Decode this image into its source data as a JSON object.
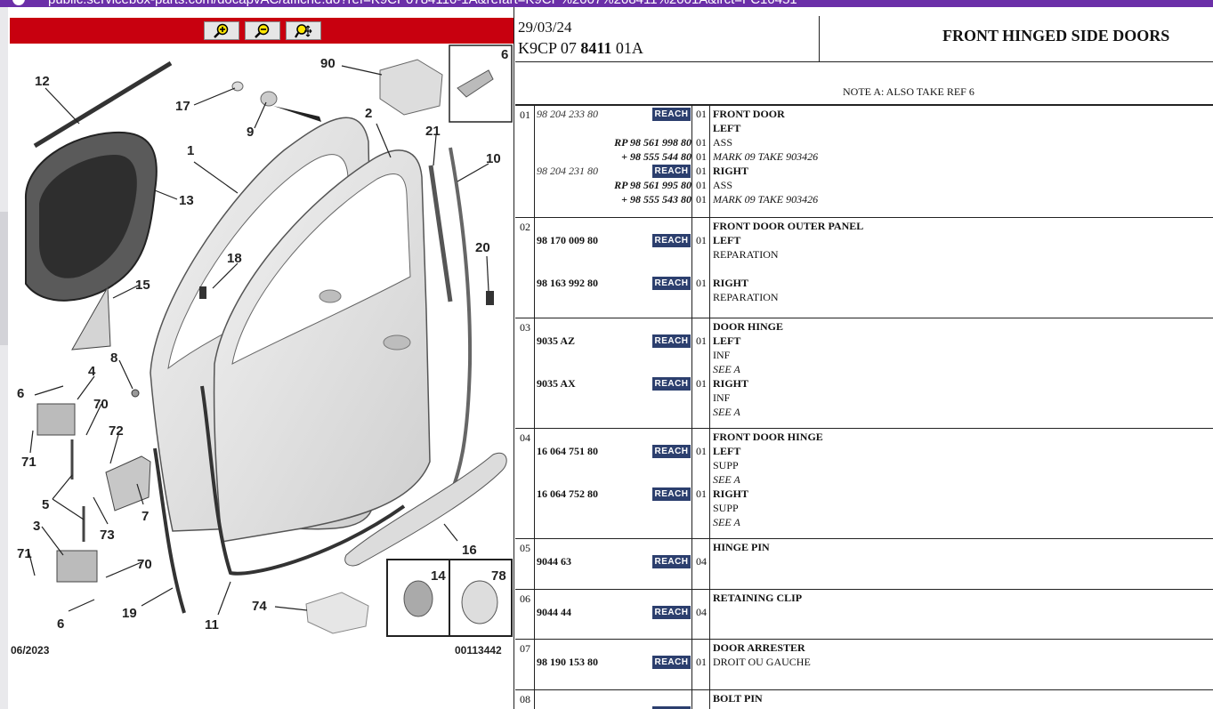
{
  "browser": {
    "url": "public.servicebox-parts.com/docapvAC/affiche.do?ref=K9CP0784110-1A&refart=K9CP%2007%208411%2001A&lrct=FC10451"
  },
  "diagram": {
    "toolbar": {
      "zoom_in": "zoom-in",
      "zoom_out": "zoom-out",
      "pan": "zoom-pan"
    },
    "labels": [
      "12",
      "17",
      "9",
      "90",
      "6",
      "2",
      "21",
      "10",
      "1",
      "13",
      "18",
      "20",
      "15",
      "8",
      "4",
      "6",
      "70",
      "72",
      "71",
      "5",
      "7",
      "73",
      "3",
      "71",
      "70",
      "6",
      "19",
      "11",
      "74",
      "14",
      "78",
      "16"
    ],
    "date": "06/2023",
    "ref": "00113442"
  },
  "header": {
    "date": "29/03/24",
    "code_prefix": "K9CP 07",
    "code_bold": "8411",
    "code_suffix": "01A",
    "title": "FRONT HINGED SIDE DOORS",
    "note": "NOTE A: ALSO TAKE REF 6"
  },
  "reach_label": "REACH",
  "rows": [
    {
      "num": "01",
      "lines": [
        {
          "ref": "98 204 233 80",
          "style": "it",
          "reach": true,
          "qty": "01",
          "desc": "FRONT DOOR",
          "dstyle": "b",
          "desc_first": true
        },
        {
          "desc": "LEFT",
          "dstyle": "b"
        },
        {
          "ref": "RP 98 561 998 80",
          "style": "rp",
          "qty": "01",
          "desc": "ASS"
        },
        {
          "ref": "+ 98 555 544 80",
          "style": "rp",
          "qty": "01",
          "desc": "MARK 09 TAKE 903426",
          "dstyle": "it"
        },
        {
          "ref": "98 204 231 80",
          "style": "it",
          "reach": true,
          "qty": "01",
          "desc": "RIGHT",
          "dstyle": "b"
        },
        {
          "ref": "RP 98 561 995 80",
          "style": "rp",
          "qty": "01",
          "desc": "ASS"
        },
        {
          "ref": "+ 98 555 543 80",
          "style": "rp",
          "qty": "01",
          "desc": "MARK 09 TAKE 903426",
          "dstyle": "it"
        }
      ]
    },
    {
      "num": "02",
      "lines": [
        {
          "desc": "FRONT DOOR OUTER PANEL",
          "dstyle": "b"
        },
        {
          "ref": "98 170 009 80",
          "style": "b",
          "reach": true,
          "qty": "01",
          "desc": "LEFT",
          "dstyle": "b"
        },
        {
          "desc": "REPARATION"
        },
        {
          "desc": ""
        },
        {
          "ref": "98 163 992 80",
          "style": "b",
          "reach": true,
          "qty": "01",
          "desc": "RIGHT",
          "dstyle": "b"
        },
        {
          "desc": "REPARATION"
        }
      ]
    },
    {
      "num": "03",
      "lines": [
        {
          "desc": "DOOR HINGE",
          "dstyle": "b"
        },
        {
          "ref": "9035 AZ",
          "style": "b",
          "reach": true,
          "qty": "01",
          "desc": "LEFT",
          "dstyle": "b"
        },
        {
          "desc": "INF"
        },
        {
          "desc": "SEE A",
          "dstyle": "it"
        },
        {
          "ref": "9035 AX",
          "style": "b",
          "reach": true,
          "qty": "01",
          "desc": "RIGHT",
          "dstyle": "b"
        },
        {
          "desc": "INF"
        },
        {
          "desc": "SEE A",
          "dstyle": "it"
        }
      ]
    },
    {
      "num": "04",
      "lines": [
        {
          "desc": "FRONT DOOR HINGE",
          "dstyle": "b"
        },
        {
          "ref": "16 064 751 80",
          "style": "b",
          "reach": true,
          "qty": "01",
          "desc": "LEFT",
          "dstyle": "b"
        },
        {
          "desc": "SUPP"
        },
        {
          "desc": "SEE A",
          "dstyle": "it"
        },
        {
          "ref": "16 064 752 80",
          "style": "b",
          "reach": true,
          "qty": "01",
          "desc": "RIGHT",
          "dstyle": "b"
        },
        {
          "desc": "SUPP"
        },
        {
          "desc": "SEE A",
          "dstyle": "it"
        }
      ]
    },
    {
      "num": "05",
      "lines": [
        {
          "desc": "HINGE PIN",
          "dstyle": "b"
        },
        {
          "ref": "9044 63",
          "style": "b",
          "reach": true,
          "qty": "04",
          "desc": ""
        }
      ]
    },
    {
      "num": "06",
      "lines": [
        {
          "desc": "RETAINING CLIP",
          "dstyle": "b"
        },
        {
          "ref": "9044 44",
          "style": "b",
          "reach": true,
          "qty": "04",
          "desc": ""
        }
      ]
    },
    {
      "num": "07",
      "lines": [
        {
          "desc": "DOOR ARRESTER",
          "dstyle": "b"
        },
        {
          "ref": "98 190 153 80",
          "style": "b",
          "reach": true,
          "qty": "01",
          "desc": "DROIT OU GAUCHE"
        }
      ]
    },
    {
      "num": "08",
      "lines": [
        {
          "desc": "BOLT PIN",
          "dstyle": "b"
        },
        {
          "ref": "",
          "reach": true,
          "qty": "",
          "desc": ""
        }
      ]
    }
  ]
}
